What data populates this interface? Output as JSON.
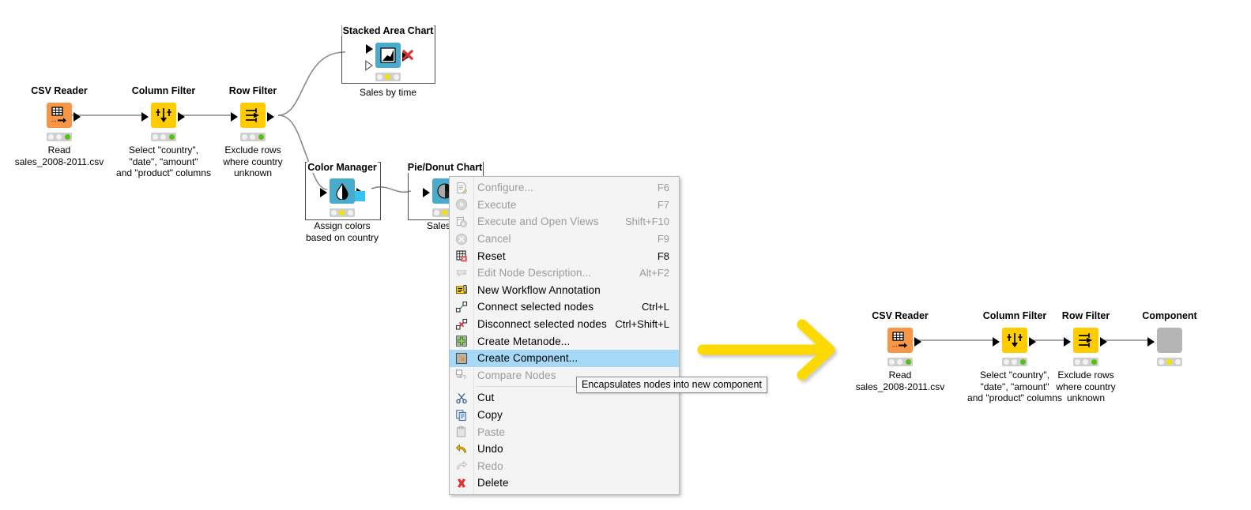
{
  "workflow_left": {
    "nodes": [
      {
        "id": "csv-reader",
        "title": "CSV Reader",
        "caption": "Read\nsales_2008-2011.csv",
        "color": "#f79646",
        "status": "green",
        "icon": "csv-reader-icon"
      },
      {
        "id": "column-filter",
        "title": "Column Filter",
        "caption": "Select \"country\",\n\"date\", \"amount\"\nand \"product\" columns",
        "color": "#ffcc00",
        "status": "green",
        "icon": "column-filter-icon"
      },
      {
        "id": "row-filter",
        "title": "Row Filter",
        "caption": "Exclude rows\nwhere country\nunknown",
        "color": "#ffcc00",
        "status": "green",
        "icon": "row-filter-icon"
      },
      {
        "id": "stacked-area-chart",
        "title": "Stacked Area Chart",
        "caption": "Sales by time",
        "color": "#4aabcd",
        "status": "yellow",
        "icon": "area-chart-icon",
        "selected": true
      },
      {
        "id": "color-manager",
        "title": "Color Manager",
        "caption": "Assign colors\nbased on country",
        "color": "#4aabcd",
        "status": "yellow",
        "icon": "color-drop-icon",
        "selected": true
      },
      {
        "id": "pie-donut-chart",
        "title": "Pie/Donut Chart",
        "caption": "Sales by",
        "color": "#4aabcd",
        "status": "yellow",
        "icon": "pie-chart-icon",
        "selected": true
      }
    ]
  },
  "workflow_right": {
    "nodes": [
      {
        "id": "csv-reader-2",
        "title": "CSV Reader",
        "caption": "Read\nsales_2008-2011.csv",
        "color": "#f79646",
        "status": "green",
        "icon": "csv-reader-icon"
      },
      {
        "id": "column-filter-2",
        "title": "Column Filter",
        "caption": "Select \"country\",\n\"date\", \"amount\"\nand \"product\" columns",
        "color": "#ffcc00",
        "status": "green",
        "icon": "column-filter-icon"
      },
      {
        "id": "row-filter-2",
        "title": "Row Filter",
        "caption": "Exclude rows\nwhere country\nunknown",
        "color": "#ffcc00",
        "status": "green",
        "icon": "row-filter-icon"
      },
      {
        "id": "component",
        "title": "Component",
        "caption": "",
        "color": "#b5b5b5",
        "status": "yellow",
        "icon": "component-icon"
      }
    ]
  },
  "context_menu": {
    "items": [
      {
        "label": "Configure...",
        "shortcut": "F6",
        "icon": "configure-icon",
        "disabled": true,
        "selected": false
      },
      {
        "label": "Execute",
        "shortcut": "F7",
        "icon": "execute-icon",
        "disabled": true,
        "selected": false
      },
      {
        "label": "Execute and Open Views",
        "shortcut": "Shift+F10",
        "icon": "execute-views-icon",
        "disabled": true,
        "selected": false
      },
      {
        "label": "Cancel",
        "shortcut": "F9",
        "icon": "cancel-icon",
        "disabled": true,
        "selected": false
      },
      {
        "label": "Reset",
        "shortcut": "F8",
        "icon": "reset-icon",
        "disabled": false,
        "selected": false
      },
      {
        "label": "Edit Node Description...",
        "shortcut": "Alt+F2",
        "icon": "edit-description-icon",
        "disabled": true,
        "selected": false
      },
      {
        "label": "New Workflow Annotation",
        "shortcut": "",
        "icon": "annotation-icon",
        "disabled": false,
        "selected": false
      },
      {
        "label": "Connect selected nodes",
        "shortcut": "Ctrl+L",
        "icon": "connect-icon",
        "disabled": false,
        "selected": false
      },
      {
        "label": "Disconnect selected nodes",
        "shortcut": "Ctrl+Shift+L",
        "icon": "disconnect-icon",
        "disabled": false,
        "selected": false
      },
      {
        "label": "Create Metanode...",
        "shortcut": "",
        "icon": "metanode-icon",
        "disabled": false,
        "selected": false
      },
      {
        "label": "Create Component...",
        "shortcut": "",
        "icon": "component-create-icon",
        "disabled": false,
        "selected": true
      },
      {
        "label": "Compare Nodes",
        "shortcut": "",
        "icon": "compare-nodes-icon",
        "disabled": true,
        "selected": false
      },
      {
        "label": "Cut",
        "shortcut": "",
        "icon": "cut-icon",
        "disabled": false,
        "selected": false
      },
      {
        "label": "Copy",
        "shortcut": "",
        "icon": "copy-icon",
        "disabled": false,
        "selected": false
      },
      {
        "label": "Paste",
        "shortcut": "",
        "icon": "paste-icon",
        "disabled": true,
        "selected": false
      },
      {
        "label": "Undo",
        "shortcut": "",
        "icon": "undo-icon",
        "disabled": false,
        "selected": false
      },
      {
        "label": "Redo",
        "shortcut": "",
        "icon": "redo-icon",
        "disabled": true,
        "selected": false
      },
      {
        "label": "Delete",
        "shortcut": "",
        "icon": "delete-icon",
        "disabled": false,
        "selected": false
      }
    ],
    "highlight_color": "#a6d9f7"
  },
  "tooltip": {
    "text": "Encapsulates nodes into new component"
  },
  "arrow": {
    "name": "transformation-arrow",
    "color": "#ffd700",
    "direction": "right"
  }
}
